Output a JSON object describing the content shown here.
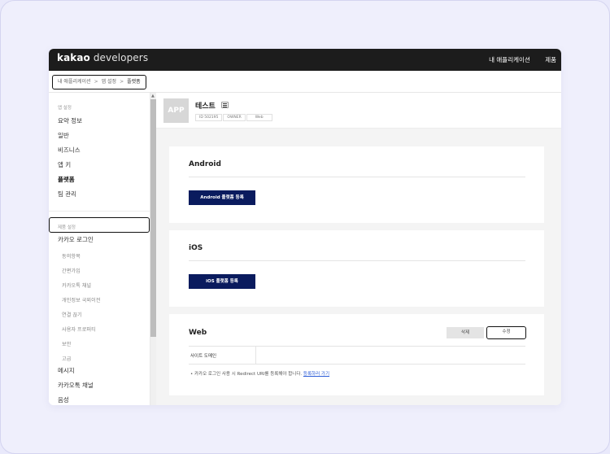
{
  "brand": {
    "name_bold": "kakao",
    "name_rest": " developers"
  },
  "topnav": {
    "my_apps": "내 애플리케이션",
    "products": "제품"
  },
  "breadcrumb": {
    "items": [
      "내 애플리케이션",
      "앱 설정",
      "플랫폼"
    ],
    "separator": ">"
  },
  "sidebar": {
    "section_app": "앱 설정",
    "items": [
      "요약 정보",
      "일반",
      "비즈니스",
      "앱 키",
      "플랫폼",
      "팀 관리"
    ],
    "active_index": 4,
    "section_product": "제품 설정",
    "product_item": "카카오 로그인",
    "sub_items": [
      "동의항목",
      "간편가입",
      "카카오톡 채널",
      "개인정보 국외이전",
      "연결 끊기",
      "사용자 프로퍼티",
      "보안",
      "고급"
    ],
    "bottom_items": [
      "메시지",
      "카카오톡 채널",
      "음성"
    ]
  },
  "app": {
    "thumb_label": "APP",
    "name": "테스트",
    "tags": [
      "ID 502195",
      "OWNER",
      "Web"
    ]
  },
  "android": {
    "title": "Android",
    "button": "Android 플랫폼 등록"
  },
  "ios": {
    "title": "iOS",
    "button": "iOS 플랫폼 등록"
  },
  "web": {
    "title": "Web",
    "delete_button": "삭제",
    "edit_button": "수정",
    "domain_label": "사이트 도메인",
    "note_prefix": "•  카카오 로그인 사용 시 Redirect URI를 등록해야 합니다.",
    "note_link": "등록하러 가기"
  },
  "colors": {
    "topbar": "#1c1c1c",
    "primary_button": "#0a1b5e",
    "link": "#2a5bd7",
    "page_bg": "#e9e9fb"
  }
}
